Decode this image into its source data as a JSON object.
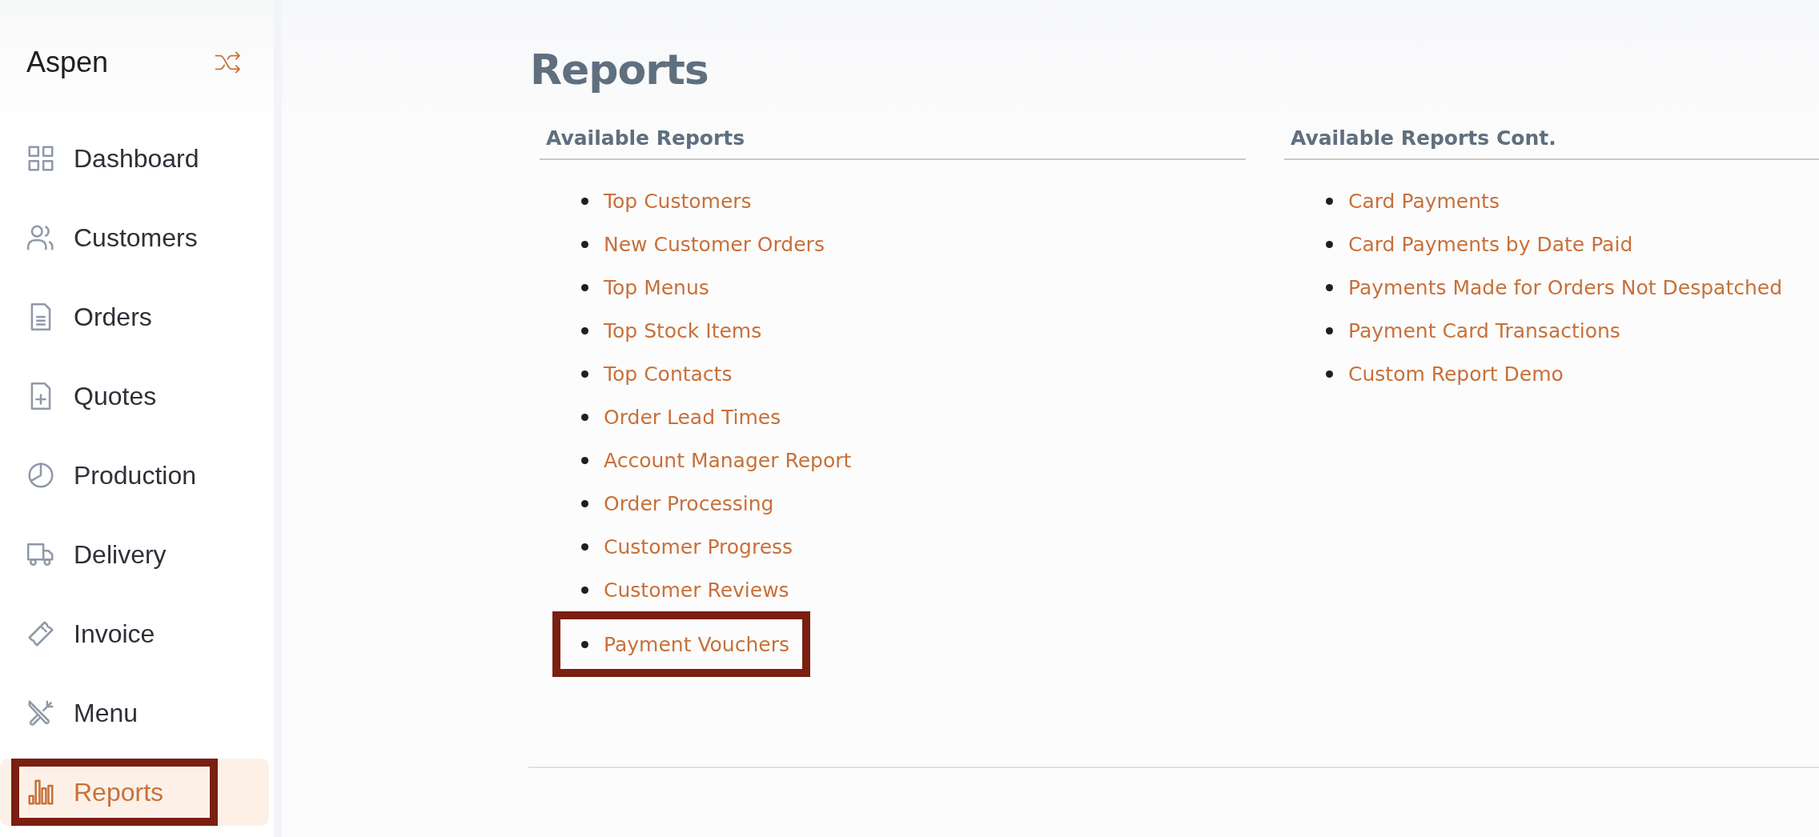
{
  "sidebar": {
    "brand": "Aspen",
    "items": [
      {
        "label": "Dashboard",
        "selected": false,
        "highlighted": false
      },
      {
        "label": "Customers",
        "selected": false,
        "highlighted": false
      },
      {
        "label": "Orders",
        "selected": false,
        "highlighted": false
      },
      {
        "label": "Quotes",
        "selected": false,
        "highlighted": false
      },
      {
        "label": "Production",
        "selected": false,
        "highlighted": false
      },
      {
        "label": "Delivery",
        "selected": false,
        "highlighted": false
      },
      {
        "label": "Invoice",
        "selected": false,
        "highlighted": false
      },
      {
        "label": "Menu",
        "selected": false,
        "highlighted": false
      },
      {
        "label": "Reports",
        "selected": true,
        "highlighted": true
      }
    ]
  },
  "page": {
    "title": "Reports",
    "columns": [
      {
        "heading": "Available Reports",
        "links": [
          {
            "label": "Top Customers",
            "highlighted": false
          },
          {
            "label": "New Customer Orders",
            "highlighted": false
          },
          {
            "label": "Top Menus",
            "highlighted": false
          },
          {
            "label": "Top Stock Items",
            "highlighted": false
          },
          {
            "label": "Top Contacts",
            "highlighted": false
          },
          {
            "label": "Order Lead Times",
            "highlighted": false
          },
          {
            "label": "Account Manager Report",
            "highlighted": false
          },
          {
            "label": "Order Processing",
            "highlighted": false
          },
          {
            "label": "Customer Progress",
            "highlighted": false
          },
          {
            "label": "Customer Reviews",
            "highlighted": false
          },
          {
            "label": "Payment Vouchers",
            "highlighted": true
          }
        ]
      },
      {
        "heading": "Available Reports Cont.",
        "links": [
          {
            "label": "Card Payments",
            "highlighted": false
          },
          {
            "label": "Card Payments by Date Paid",
            "highlighted": false
          },
          {
            "label": "Payments Made for Orders Not Despatched",
            "highlighted": false
          },
          {
            "label": "Payment Card Transactions",
            "highlighted": false
          },
          {
            "label": "Custom Report Demo",
            "highlighted": false
          }
        ]
      }
    ]
  }
}
